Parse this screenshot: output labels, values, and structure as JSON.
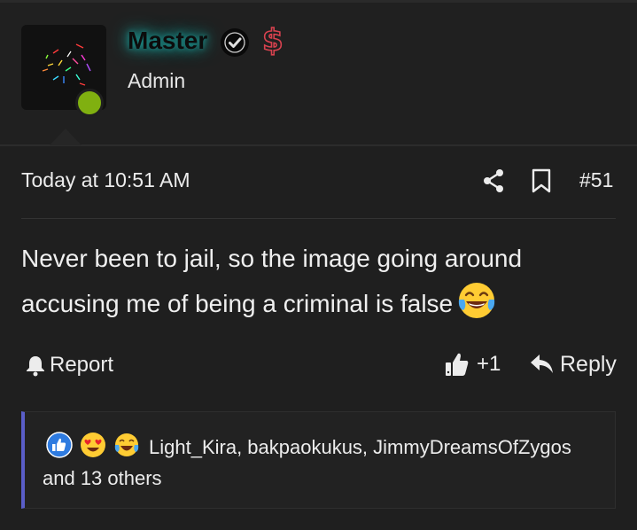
{
  "user": {
    "name": "Master",
    "role": "Admin",
    "online": true
  },
  "post": {
    "timestamp": "Today at 10:51 AM",
    "number": "#51",
    "body": "Never been to jail, so the image going around accusing me of being a criminal is false"
  },
  "actions": {
    "report_label": "Report",
    "like_count": "+1",
    "reply_label": "Reply"
  },
  "reactions": {
    "text": "Light_Kira, bakpaokukus, JimmyDreamsOfZygos and 13 others",
    "icons": [
      "like-icon",
      "heart-eyes-icon",
      "tears-of-joy-icon"
    ]
  },
  "colors": {
    "background": "#1f1f1f",
    "username_glow": "#1f9d98",
    "online": "#80b010",
    "dollar": "#d8424f",
    "reaction_bar": "#5a5ec8"
  }
}
